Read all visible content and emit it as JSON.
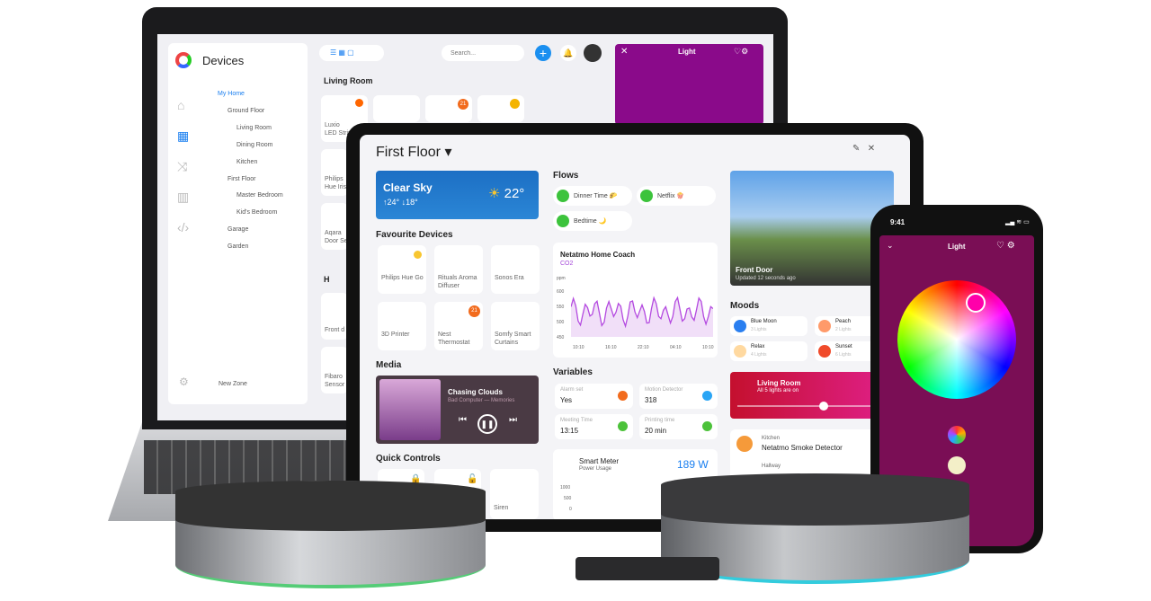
{
  "laptop": {
    "sidebar": {
      "title": "Devices",
      "tree": [
        "My Home",
        "Ground Floor",
        "Living Room",
        "Dining Room",
        "Kitchen",
        "First Floor",
        "Master Bedroom",
        "Kid's Bedroom",
        "Garage",
        "Garden"
      ],
      "new_zone": "New Zone"
    },
    "search_placeholder": "Search...",
    "section": "Living Room",
    "devices": [
      {
        "name": "Luxio",
        "sub": "LED Strip"
      },
      {
        "name": "Philips",
        "sub": "Hue Iris"
      },
      {
        "name": "Aqara",
        "sub": "Door Se"
      },
      {
        "name": "Front d",
        "sub": ""
      },
      {
        "name": "Fibaro",
        "sub": "Sensor"
      }
    ],
    "badge_value": "21",
    "section2": "H",
    "light_panel": {
      "title": "Light",
      "color": "#8a0a8a"
    }
  },
  "tablet": {
    "title": "First Floor",
    "weather": {
      "condition": "Clear Sky",
      "high": "↑24°",
      "low": "↓18°",
      "temp": "22°"
    },
    "favourites_title": "Favourite Devices",
    "favourites": [
      "Philips Hue Go",
      "Rituals Aroma Diffuser",
      "Sonos Era",
      "3D Printer",
      "Nest Thermostat",
      "Somfy Smart Curtains"
    ],
    "thermostat_badge": "21",
    "flows_title": "Flows",
    "flows": [
      "Dinner Time 🌮",
      "Netflix 🍿",
      "Bedtime 🌙"
    ],
    "coach": {
      "title": "Netatmo Home Coach",
      "metric": "CO2",
      "unit": "ppm",
      "yticks": [
        "600",
        "550",
        "500",
        "450"
      ],
      "xticks": [
        "10:10",
        "16:10",
        "22:10",
        "04:10",
        "10:10"
      ]
    },
    "media": {
      "title": "Media",
      "track": "Chasing Clouds",
      "artist": "Bad Computer — Memories"
    },
    "variables_title": "Variables",
    "variables": [
      {
        "label": "Alarm set",
        "value": "Yes",
        "color": "#f26b1d"
      },
      {
        "label": "Motion Detector",
        "value": "318",
        "color": "#2aa5f5"
      },
      {
        "label": "Meeting Time",
        "value": "13:15",
        "color": "#4cc23a"
      },
      {
        "label": "Printing time",
        "value": "20 min",
        "color": "#4cc23a"
      }
    ],
    "quick_title": "Quick Controls",
    "quick": [
      "",
      "",
      "Siren"
    ],
    "meter": {
      "title": "Smart Meter",
      "sub": "Power Usage",
      "value": "189 W",
      "yticks": [
        "1000",
        "500",
        "0"
      ]
    },
    "camera": {
      "title": "Front Door",
      "sub": "Updated 12 seconds ago"
    },
    "moods_title": "Moods",
    "moods": [
      {
        "name": "Blue Moon",
        "sub": "3 Lights",
        "color": "#2a7ff0"
      },
      {
        "name": "Peach",
        "sub": "2 Lights",
        "color": "#ff9a6a"
      },
      {
        "name": "Relax",
        "sub": "4 Lights",
        "color": "#ffd9a0"
      },
      {
        "name": "Sunset",
        "sub": "6 Lights",
        "color": "#f04a2a"
      }
    ],
    "room": {
      "name": "Living Room",
      "sub": "All 5 lights are on",
      "level": 0.6
    },
    "smoke": {
      "room": "Kitchen",
      "name": "Netatmo Smoke Detector",
      "room2": "Hallway"
    }
  },
  "phone": {
    "time": "9:41",
    "title": "Light"
  }
}
